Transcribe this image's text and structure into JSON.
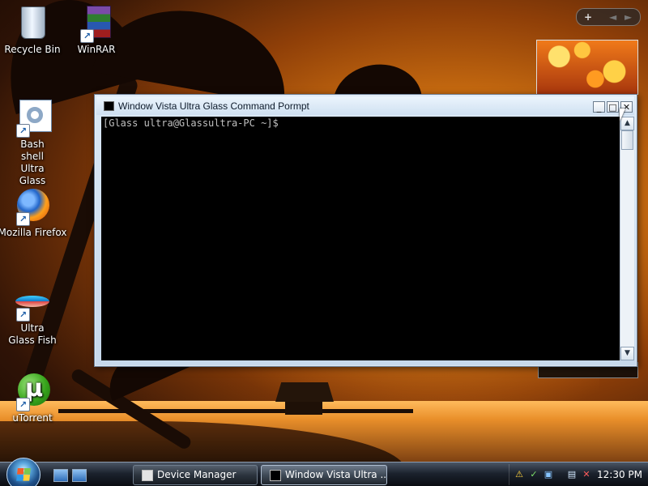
{
  "desktop": {
    "icons": [
      {
        "label": "Recycle Bin",
        "icon": "recycle-bin-icon",
        "shortcut": false
      },
      {
        "label": "WinRAR",
        "icon": "winrar-icon",
        "shortcut": true
      },
      {
        "label": "Bash shell Ultra Glass",
        "icon": "settings-gear-icon",
        "shortcut": true
      },
      {
        "label": "Mozilla Firefox",
        "icon": "firefox-icon",
        "shortcut": true
      },
      {
        "label": "Ultra Glass Fish",
        "icon": "fish-icon",
        "shortcut": true
      },
      {
        "label": "uTorrent",
        "icon": "utorrent-icon",
        "shortcut": true
      }
    ]
  },
  "sidebar": {
    "add_symbol": "+",
    "prev_symbol": "◄",
    "next_symbol": "►"
  },
  "window": {
    "title": "Window Vista Ultra Glass Command Pormpt",
    "minimize_symbol": "_",
    "maximize_symbol": "□",
    "close_symbol": "✕",
    "console_text": "[Glass ultra@Glassultra-PC ~]$",
    "scroll_up_symbol": "▲",
    "scroll_down_symbol": "▼"
  },
  "taskbar": {
    "tasks": [
      {
        "label": "Device Manager",
        "active": false
      },
      {
        "label": "Window Vista Ultra ...",
        "active": true
      }
    ],
    "clock": "12:30 PM",
    "tray_icons": [
      "shield-warning-icon",
      "network-icon",
      "security-center-icon",
      "network-connections-icon",
      "volume-muted-icon"
    ]
  },
  "colors": {
    "console_background": "#000000",
    "console_text": "#c0c0c0",
    "window_frame": "#dbe9f6",
    "taskbar": "#1b222d"
  }
}
